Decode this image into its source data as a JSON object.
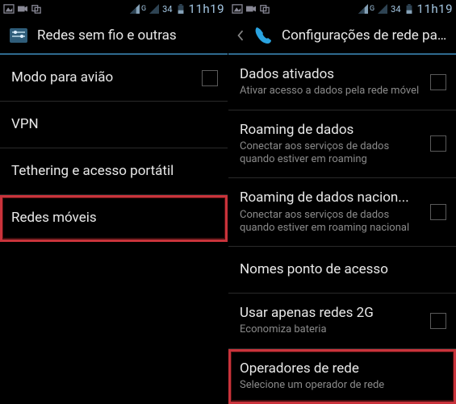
{
  "statusbar": {
    "battery": "34",
    "time": "11h19"
  },
  "left": {
    "title": "Redes sem fio e outras",
    "items": [
      {
        "title": "Modo para avião",
        "sub": "",
        "checkbox": true,
        "highlight": false
      },
      {
        "title": "VPN",
        "sub": "",
        "checkbox": false,
        "highlight": false
      },
      {
        "title": "Tethering e acesso portátil",
        "sub": "",
        "checkbox": false,
        "highlight": false
      },
      {
        "title": "Redes móveis",
        "sub": "",
        "checkbox": false,
        "highlight": true
      }
    ]
  },
  "right": {
    "title": "Configurações de rede para ce...",
    "items": [
      {
        "title": "Dados ativados",
        "sub": "Ativar acesso a dados pela rede móvel",
        "checkbox": true,
        "highlight": false
      },
      {
        "title": "Roaming de dados",
        "sub": "Conectar aos serviços de dados quando estiver em roaming",
        "checkbox": true,
        "highlight": false
      },
      {
        "title": "Roaming de dados nacion...",
        "sub": "Conectar aos serviços de dados quando estiver em roaming nacional",
        "checkbox": true,
        "highlight": false
      },
      {
        "title": "Nomes ponto de acesso",
        "sub": "",
        "checkbox": false,
        "highlight": false
      },
      {
        "title": "Usar apenas redes 2G",
        "sub": "Economiza bateria",
        "checkbox": true,
        "highlight": false
      },
      {
        "title": "Operadores de rede",
        "sub": "Selecione um operador de rede",
        "checkbox": false,
        "highlight": true
      }
    ]
  }
}
